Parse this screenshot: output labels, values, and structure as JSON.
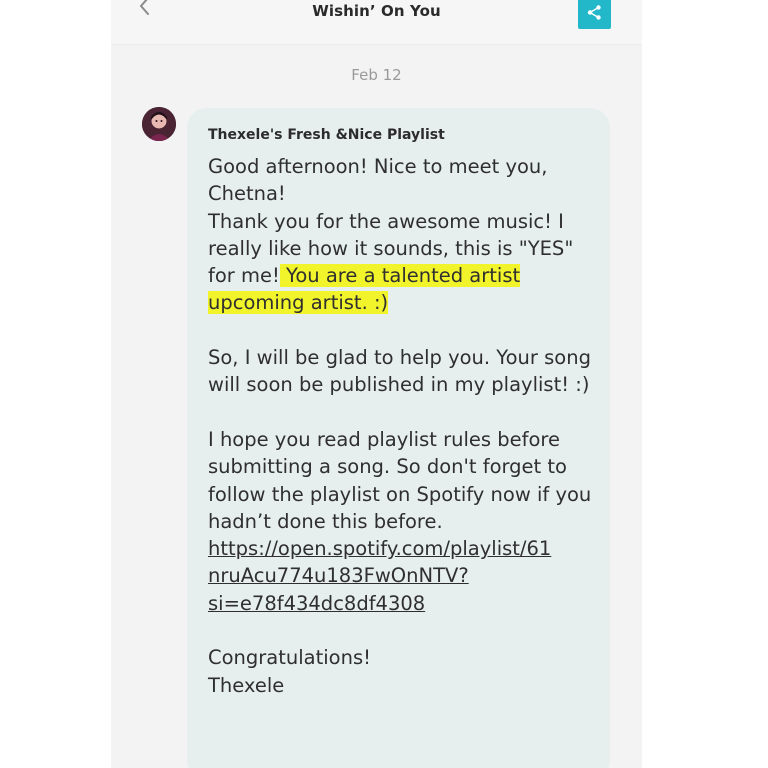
{
  "header": {
    "back_icon": "chevron-left-icon",
    "title": "Wishin’ On You",
    "share_icon": "share-icon",
    "share_color": "#22b8c9"
  },
  "conversation": {
    "date": "Feb 12",
    "message": {
      "avatar_icon": "avatar",
      "sender": "Thexele's Fresh &Nice Playlist",
      "greeting_line1": "Good afternoon! Nice to meet you,",
      "greeting_line2": "Chetna!",
      "thanks_part1": "Thank you for the awesome music! I really like how it sounds, this is \"YES\" for me!",
      "highlighted_text": " You are a talented artist upcoming artist. :)",
      "help_text": "So, I will be glad to help you. Your song will soon be published in my playlist! :)",
      "rules_text": "I hope you read playlist rules before submitting a song. So don't forget to follow the playlist on Spotify now if you hadn’t done this before.",
      "link_line1": "https://open.spotify.com/playlist/61",
      "link_line2": "nruAcu774u183FwOnNTV?",
      "link_line3": "si=e78f434dc8df4308",
      "congrats": "Congratulations!",
      "signoff": "Thexele",
      "highlight_color": "#f1f42a",
      "bubble_color": "#e7eeee"
    }
  }
}
